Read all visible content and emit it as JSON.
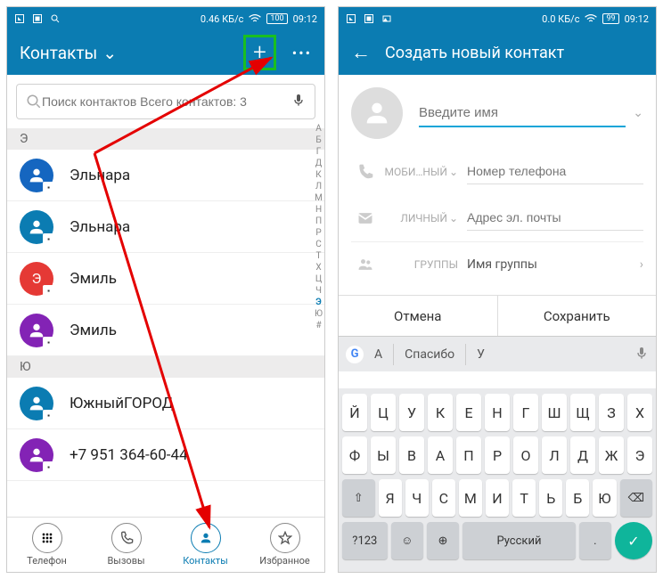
{
  "statusbar": {
    "speed_left": "0.46 КБ/с",
    "speed_right": "0.0 КБ/с",
    "time": "09:12",
    "battery_left": "100",
    "battery_right": "99"
  },
  "left": {
    "title": "Контакты",
    "search_placeholder": "Поиск контактов Всего контактов: 3",
    "sections": [
      {
        "letter": "Э",
        "contacts": [
          {
            "name": "Эльнара",
            "color": "#1566c0"
          },
          {
            "name": "Эльнара",
            "color": "#0b7cb2"
          },
          {
            "name": "Эмиль",
            "color": "#e53935",
            "initial": "Э"
          },
          {
            "name": "Эмиль",
            "color": "#8323b5"
          }
        ]
      },
      {
        "letter": "Ю",
        "contacts": [
          {
            "name": "ЮжныйГОРОД",
            "color": "#0b7cb2"
          },
          {
            "name": "+7 951 364-60-44",
            "color": "#8323b5"
          }
        ]
      }
    ],
    "index": [
      "А",
      "Б",
      "Г",
      "Д",
      "К",
      "Л",
      "М",
      "Н",
      "П",
      "Р",
      "С",
      "Т",
      "Х",
      "Ц",
      "Ч",
      "Э",
      "Ю",
      "#"
    ],
    "index_active": "Э",
    "nav": [
      {
        "label": "Телефон",
        "icon": "dialpad"
      },
      {
        "label": "Вызовы",
        "icon": "phone"
      },
      {
        "label": "Контакты",
        "icon": "person",
        "active": true
      },
      {
        "label": "Избранное",
        "icon": "star"
      }
    ]
  },
  "right": {
    "title": "Создать новый контакт",
    "name_placeholder": "Введите имя",
    "phone_label": "МОБИ…НЫЙ",
    "phone_placeholder": "Номер телефона",
    "email_label": "ЛИЧНЫЙ",
    "email_placeholder": "Адрес эл. почты",
    "group_label": "ГРУППЫ",
    "group_value": "Имя группы",
    "cancel": "Отмена",
    "save": "Сохранить",
    "suggestions": [
      "А",
      "Спасибо",
      "У"
    ],
    "keyboard": {
      "row1": [
        "Й",
        "Ц",
        "У",
        "К",
        "Е",
        "Н",
        "Г",
        "Ш",
        "Щ",
        "З",
        "Х"
      ],
      "row2": [
        "Ф",
        "Ы",
        "В",
        "А",
        "П",
        "Р",
        "О",
        "Л",
        "Д",
        "Ж",
        "Э"
      ],
      "row3": [
        "⇧",
        "Я",
        "Ч",
        "С",
        "М",
        "И",
        "Т",
        "Ь",
        "Б",
        "Ю",
        "⌫"
      ],
      "row4_sym": "?123",
      "row4_space": "Русский"
    }
  }
}
